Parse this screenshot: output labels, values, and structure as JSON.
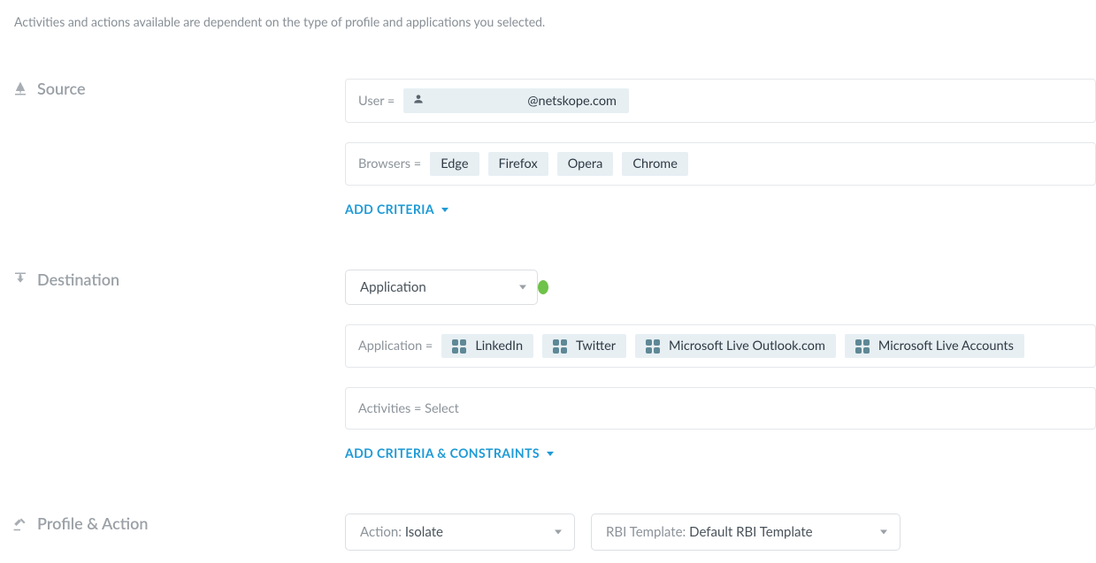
{
  "intro": "Activities and actions available are dependent on the type of profile and applications you selected.",
  "sections": {
    "source": {
      "title": "Source",
      "user_label": "User =",
      "user_value": "@netskope.com",
      "browsers_label": "Browsers =",
      "browsers": [
        "Edge",
        "Firefox",
        "Opera",
        "Chrome"
      ],
      "add": "ADD CRITERIA"
    },
    "destination": {
      "title": "Destination",
      "selector": "Application",
      "app_label": "Application =",
      "apps": [
        "LinkedIn",
        "Twitter",
        "Microsoft Live Outlook.com",
        "Microsoft Live Accounts"
      ],
      "activities_label": "Activities = Select",
      "add": "ADD CRITERIA & CONSTRAINTS"
    },
    "profile_action": {
      "title": "Profile & Action",
      "action_key": "Action:",
      "action_value": " Isolate",
      "template_key": "RBI Template:",
      "template_value": " Default RBI Template"
    }
  }
}
